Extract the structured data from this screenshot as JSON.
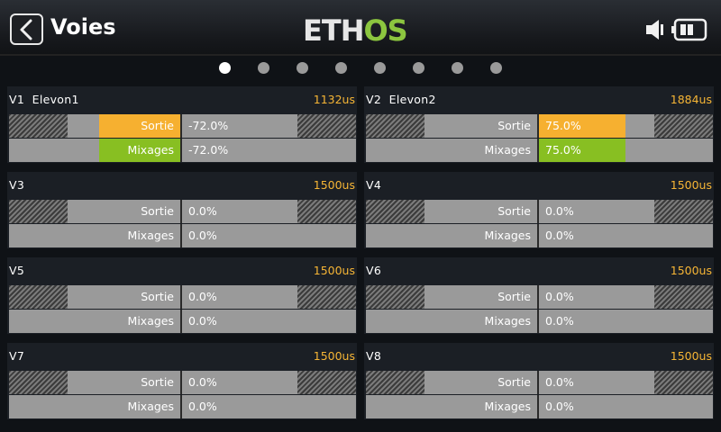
{
  "header": {
    "title": "Voies",
    "logo": "ETHOS",
    "icons": {
      "back": "chevron-left-icon",
      "speaker": "speaker-icon",
      "battery": "battery-icon"
    }
  },
  "pager": {
    "count": 8,
    "active": 0
  },
  "labels": {
    "output": "Sortie",
    "mixes": "Mixages"
  },
  "colors": {
    "accent": "#f6b535",
    "output_bar": "#f6b030",
    "mix_bar": "#88bf22"
  },
  "channels": [
    {
      "name": "V1  Elevon1",
      "pulse": "1132us",
      "output": "-72.0%",
      "mixes": "-72.0%",
      "output_level": -0.72,
      "mixes_level": -0.72
    },
    {
      "name": "V2  Elevon2",
      "pulse": "1884us",
      "output": "75.0%",
      "mixes": "75.0%",
      "output_level": 0.75,
      "mixes_level": 0.75
    },
    {
      "name": "V3",
      "pulse": "1500us",
      "output": "0.0%",
      "mixes": "0.0%",
      "output_level": 0,
      "mixes_level": 0
    },
    {
      "name": "V4",
      "pulse": "1500us",
      "output": "0.0%",
      "mixes": "0.0%",
      "output_level": 0,
      "mixes_level": 0
    },
    {
      "name": "V5",
      "pulse": "1500us",
      "output": "0.0%",
      "mixes": "0.0%",
      "output_level": 0,
      "mixes_level": 0
    },
    {
      "name": "V6",
      "pulse": "1500us",
      "output": "0.0%",
      "mixes": "0.0%",
      "output_level": 0,
      "mixes_level": 0
    },
    {
      "name": "V7",
      "pulse": "1500us",
      "output": "0.0%",
      "mixes": "0.0%",
      "output_level": 0,
      "mixes_level": 0
    },
    {
      "name": "V8",
      "pulse": "1500us",
      "output": "0.0%",
      "mixes": "0.0%",
      "output_level": 0,
      "mixes_level": 0
    }
  ]
}
